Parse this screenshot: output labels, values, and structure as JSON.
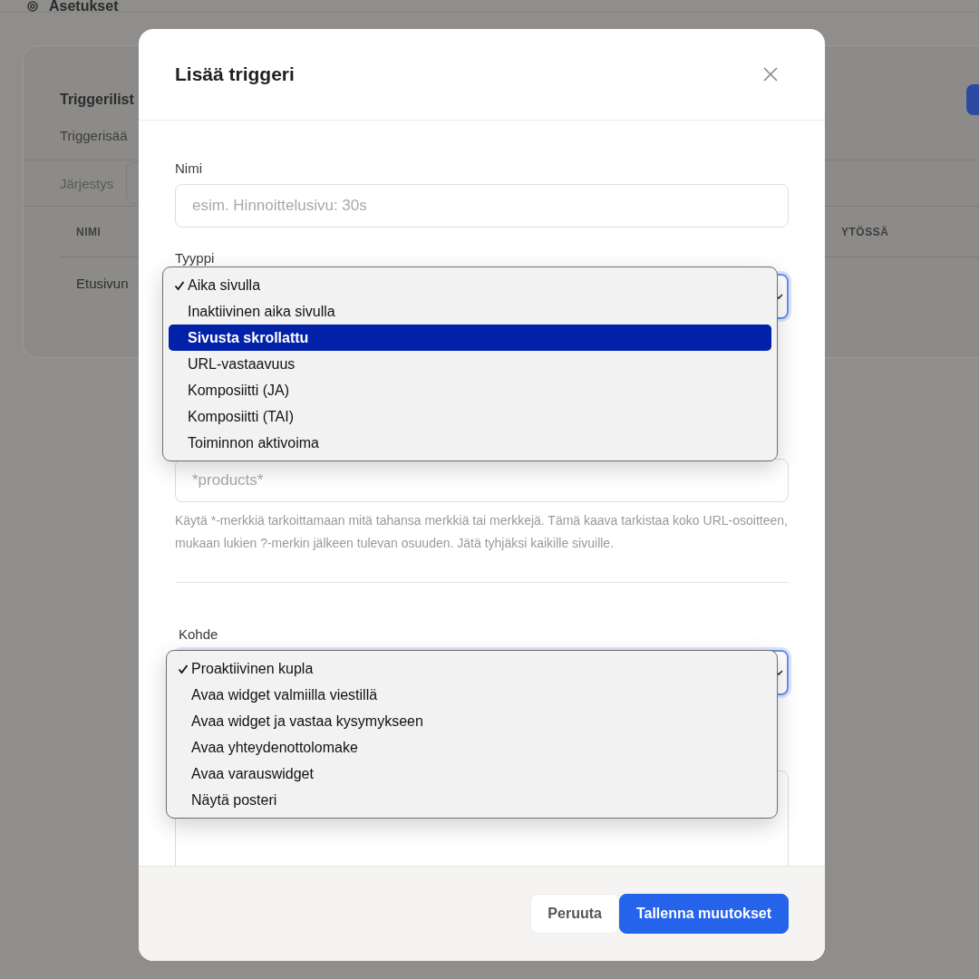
{
  "page": {
    "title": "Asetukset",
    "card_title": "Triggerilist",
    "card_subtitle": "Triggerisää",
    "order_label": "Järjestys",
    "table": {
      "columns": [
        "NIMI",
        "YTÖSSÄ"
      ],
      "rows": [
        {
          "name": "Etusivun"
        }
      ]
    }
  },
  "dialog": {
    "title": "Lisää triggeri",
    "name_field": {
      "label": "Nimi",
      "placeholder": "esim. Hinnoittelusivu: 30s"
    },
    "type_field": {
      "label": "Tyyppi",
      "options": [
        {
          "label": "Aika sivulla",
          "selected": true,
          "highlighted": false
        },
        {
          "label": "Inaktiivinen aika sivulla",
          "selected": false,
          "highlighted": false
        },
        {
          "label": "Sivusta skrollattu",
          "selected": false,
          "highlighted": true
        },
        {
          "label": "URL-vastaavuus",
          "selected": false,
          "highlighted": false
        },
        {
          "label": "Komposiitti (JA)",
          "selected": false,
          "highlighted": false
        },
        {
          "label": "Komposiitti (TAI)",
          "selected": false,
          "highlighted": false
        },
        {
          "label": "Toiminnon aktivoima",
          "selected": false,
          "highlighted": false
        }
      ]
    },
    "url_field": {
      "placeholder": "*products*",
      "help": "Käytä *-merkkiä tarkoittamaan mitä tahansa merkkiä tai merkkejä. Tämä kaava tarkistaa koko URL-osoitteen, mukaan lukien ?-merkin jälkeen tulevan osuuden. Jätä tyhjäksi kaikille sivuille."
    },
    "target_field": {
      "label": "Kohde",
      "options": [
        {
          "label": "Proaktiivinen kupla",
          "selected": true,
          "highlighted": false
        },
        {
          "label": "Avaa widget valmiilla viestillä",
          "selected": false,
          "highlighted": false
        },
        {
          "label": "Avaa widget ja vastaa kysymykseen",
          "selected": false,
          "highlighted": false
        },
        {
          "label": "Avaa yhteydenottolomake",
          "selected": false,
          "highlighted": false
        },
        {
          "label": "Avaa varauswidget",
          "selected": false,
          "highlighted": false
        },
        {
          "label": "Näytä posteri",
          "selected": false,
          "highlighted": false
        }
      ]
    },
    "buttons": [
      {
        "label": "Peruuta",
        "kind": "secondary"
      },
      {
        "label": "Tallenna muutokset",
        "kind": "primary"
      }
    ]
  }
}
